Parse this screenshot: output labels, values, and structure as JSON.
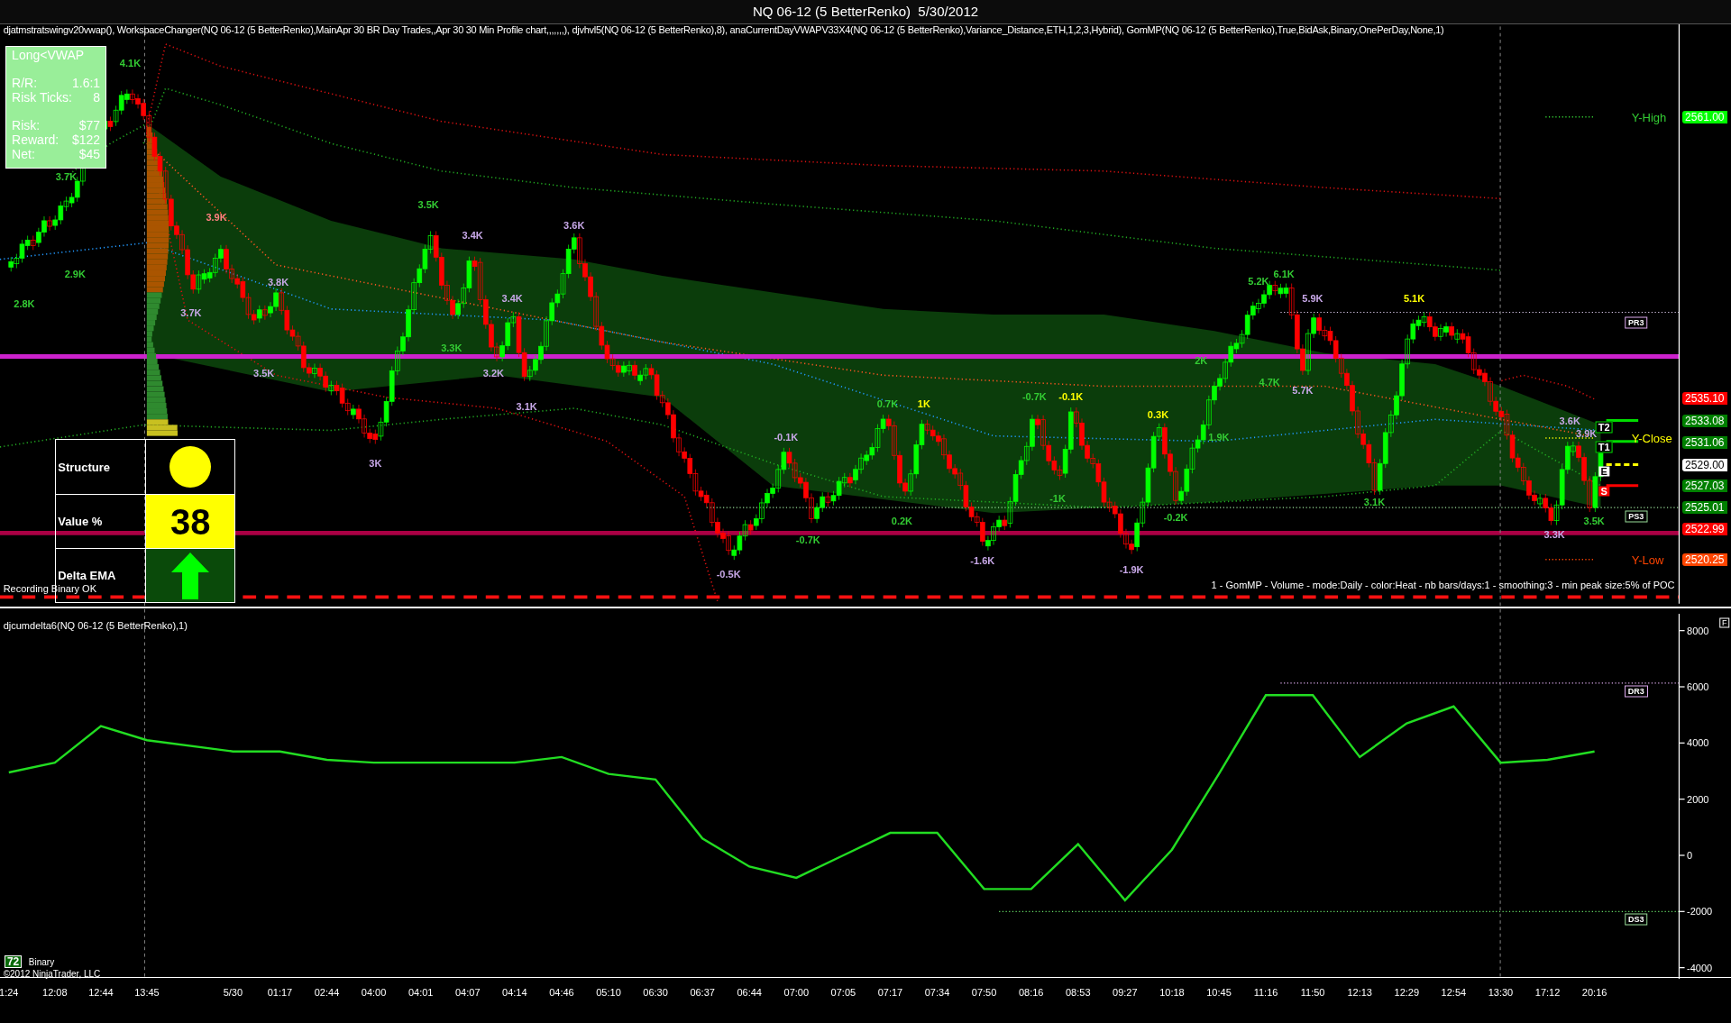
{
  "window": {
    "title": "NQ 06-12 (5 BetterRenko)  5/30/2012"
  },
  "price_panel": {
    "indicators": "djatmstratswingv20vwap(), WorkspaceChanger(NQ 06-12 (5 BetterRenko),MainApr 30 BR Day Trades,,Apr 30 30 Min Profile chart,,,,,,,), djvhvl5(NQ 06-12 (5 BetterRenko),8), anaCurrentDayVWAPV33X4(NQ 06-12 (5 BetterRenko),Variance_Distance,ETH,1,2,3,Hybrid), GomMP(NQ 06-12 (5 BetterRenko),True,BidAsk,Binary,OnePerDay,None,1)",
    "trade_box": {
      "title": "Long<VWAP",
      "rows": [
        {
          "label": "R/R:",
          "value": "1.6:1"
        },
        {
          "label": "Risk Ticks:",
          "value": "8"
        },
        {
          "label": "Risk:",
          "value": "$77"
        },
        {
          "label": "Reward:",
          "value": "$122"
        },
        {
          "label": "Net:",
          "value": "$45"
        }
      ]
    },
    "signal_table": [
      {
        "label": "Structure",
        "kind": "circle"
      },
      {
        "label": "Value %",
        "kind": "number",
        "value": "38"
      },
      {
        "label": "Delta EMA",
        "kind": "arrow"
      }
    ],
    "swing_labels": [
      {
        "text": "4.1K",
        "color": "#33cc33"
      },
      {
        "text": "3.7K",
        "color": "#33cc33"
      },
      {
        "text": "2.9K",
        "color": "#33cc33"
      },
      {
        "text": "2.8K",
        "color": "#33cc33"
      },
      {
        "text": "3.9K",
        "color": "#ff8080"
      },
      {
        "text": "3.7K",
        "color": "#c8a8e8"
      },
      {
        "text": "3.8K",
        "color": "#c8a8e8"
      },
      {
        "text": "3.5K",
        "color": "#c8a8e8"
      },
      {
        "text": "3.5K",
        "color": "#33cc33"
      },
      {
        "text": "3.3K",
        "color": "#33cc33"
      },
      {
        "text": "3.4K",
        "color": "#c8a8e8"
      },
      {
        "text": "3.4K",
        "color": "#c8a8e8"
      },
      {
        "text": "3.2K",
        "color": "#c8a8e8"
      },
      {
        "text": "3.1K",
        "color": "#c8a8e8"
      },
      {
        "text": "3.6K",
        "color": "#c8a8e8"
      },
      {
        "text": "3K",
        "color": "#c8a8e8"
      },
      {
        "text": "-0.5K",
        "color": "#c8a8e8"
      },
      {
        "text": "-0.7K",
        "color": "#33cc33"
      },
      {
        "text": "-0.1K",
        "color": "#c8a8e8"
      },
      {
        "text": "0.7K",
        "color": "#33cc33"
      },
      {
        "text": "1K",
        "color": "#ffff00"
      },
      {
        "text": "0.2K",
        "color": "#33cc33"
      },
      {
        "text": "-1.6K",
        "color": "#c8a8e8"
      },
      {
        "text": "-0.7K",
        "color": "#33cc33"
      },
      {
        "text": "-0.1K",
        "color": "#ffff00"
      },
      {
        "text": "-1K",
        "color": "#33cc33"
      },
      {
        "text": "0.3K",
        "color": "#ffff00"
      },
      {
        "text": "-0.2K",
        "color": "#33cc33"
      },
      {
        "text": "-1.9K",
        "color": "#c8a8e8"
      },
      {
        "text": "1.9K",
        "color": "#33cc33"
      },
      {
        "text": "2K",
        "color": "#33cc33"
      },
      {
        "text": "5.2K",
        "color": "#33cc33"
      },
      {
        "text": "6.1K",
        "color": "#33cc33"
      },
      {
        "text": "4.7K",
        "color": "#33cc33"
      },
      {
        "text": "5.9K",
        "color": "#c8a8e8"
      },
      {
        "text": "5.7K",
        "color": "#c8a8e8"
      },
      {
        "text": "5.1K",
        "color": "#ffff00"
      },
      {
        "text": "3.1K",
        "color": "#33cc33"
      },
      {
        "text": "3.6K",
        "color": "#c8a8e8"
      },
      {
        "text": "3.9K",
        "color": "#c8a8e8"
      },
      {
        "text": "3.3K",
        "color": "#c8a8e8"
      },
      {
        "text": "3.5K",
        "color": "#33cc33"
      }
    ],
    "level_lines": [
      {
        "label": "Y-High",
        "color": "#33cc33"
      },
      {
        "label": "Y-Close",
        "color": "#ffff00"
      },
      {
        "label": "Y-Low",
        "color": "#ff4400"
      }
    ],
    "pivot_tags": [
      "PR3",
      "PS3"
    ],
    "trade_markers": [
      {
        "label": "T2",
        "kind": "target"
      },
      {
        "label": "T1",
        "kind": "target"
      },
      {
        "label": "E",
        "kind": "entry"
      },
      {
        "label": "S",
        "kind": "stop"
      }
    ],
    "price_tags": [
      {
        "text": "2561.00",
        "color": "#00ff00"
      },
      {
        "text": "2535.10",
        "color": "#ff0000"
      },
      {
        "text": "2533.08",
        "color": "#008000"
      },
      {
        "text": "2531.06",
        "color": "#008000"
      },
      {
        "text": "2529.00",
        "color": "#ffffff"
      },
      {
        "text": "2527.03",
        "color": "#008000"
      },
      {
        "text": "2525.01",
        "color": "#008000"
      },
      {
        "text": "2522.99",
        "color": "#ff0000"
      },
      {
        "text": "2520.25",
        "color": "#ff4500"
      }
    ],
    "status": "Recording Binary OK",
    "profile_caption": "1 - GomMP - Volume - mode:Daily  - color:Heat - nb bars/days:1 - smoothing:3 - min peak size:5% of POC"
  },
  "delta_panel": {
    "indicator": "djcumdelta6(NQ 06-12 (5 BetterRenko),1)",
    "panel_button": "F",
    "pivot_tags": [
      "DR3",
      "DS3"
    ],
    "chart_data": {
      "type": "line",
      "categories": [
        "1:24",
        "12:08",
        "12:44",
        "13:45",
        "5/30",
        "01:17",
        "02:44",
        "04:00",
        "04:01",
        "04:07",
        "04:14",
        "04:46",
        "05:10",
        "06:30",
        "06:37",
        "06:44",
        "07:00",
        "07:05",
        "07:17",
        "07:34",
        "07:50",
        "08:16",
        "08:53",
        "09:27",
        "10:18",
        "10:45",
        "11:16",
        "11:50",
        "12:13",
        "12:29",
        "12:54",
        "13:30",
        "17:12",
        "20:16"
      ],
      "values": [
        2950,
        3300,
        4600,
        4100,
        3700,
        3700,
        3400,
        3300,
        3300,
        3300,
        3300,
        3500,
        2900,
        2700,
        600,
        -400,
        -800,
        0,
        800,
        800,
        -1200,
        -1200,
        400,
        -1600,
        200,
        2900,
        5700,
        5700,
        3500,
        4700,
        5300,
        3300,
        3400,
        3700
      ],
      "ylim": [
        -4400,
        8600
      ],
      "yticks": [
        8000,
        6000,
        4000,
        2000,
        0,
        -2000,
        -4000
      ]
    }
  },
  "footer": {
    "badge": "72",
    "mode": "Binary",
    "copyright": "©2012 NinjaTrader, LLC"
  }
}
